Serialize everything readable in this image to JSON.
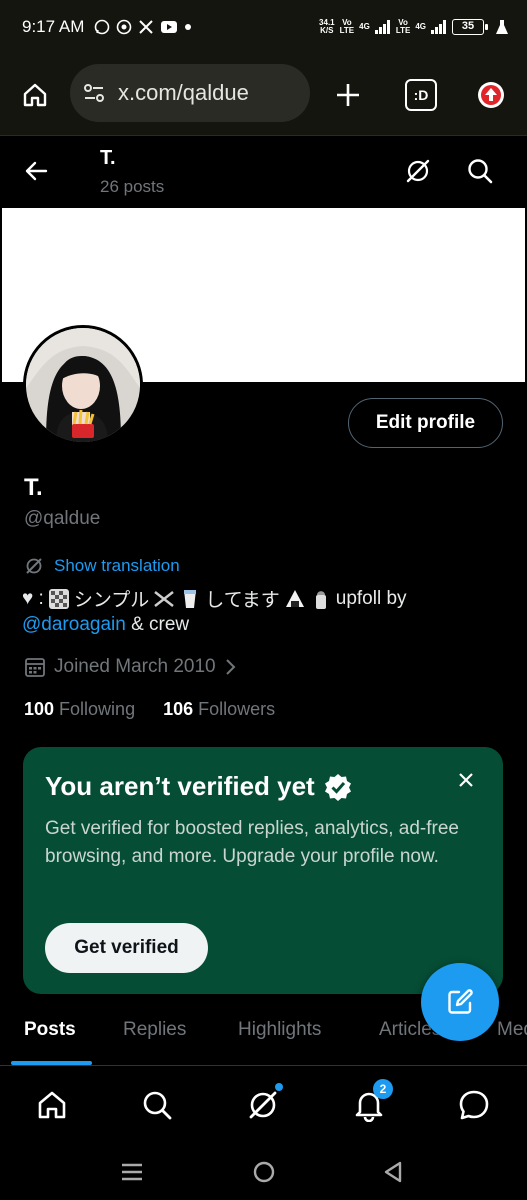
{
  "status_bar": {
    "time": "9:17 AM",
    "speed_value": "34.1",
    "speed_unit": "K/S",
    "sim1_top": "Vo",
    "sim1_bottom": "LTE",
    "net1": "4G",
    "sim2_top": "Vo",
    "sim2_bottom": "LTE",
    "net2": "4G",
    "battery": "35"
  },
  "browser": {
    "url": "x.com/qaldue",
    "tab_switcher_label": ":D"
  },
  "header": {
    "title": "T.",
    "post_count": "26 posts"
  },
  "profile": {
    "display_name": "T.",
    "handle": "@qaldue",
    "edit_label": "Edit profile",
    "show_translation": "Show translation",
    "bio_prefix": "♥︎ : ",
    "bio_word1": " シンプル ",
    "bio_word2": " してます ",
    "bio_word3": " upfoll by",
    "bio_mention": "@daroagain",
    "bio_suffix": " & crew",
    "joined": "Joined March 2010",
    "following_count": "100",
    "following_label": "Following",
    "followers_count": "106",
    "followers_label": "Followers"
  },
  "verify_card": {
    "title": "You aren’t verified yet",
    "description": "Get verified for boosted replies, analytics, ad-free browsing, and more. Upgrade your profile now.",
    "button": "Get verified"
  },
  "tabs": [
    "Posts",
    "Replies",
    "Highlights",
    "Articles",
    "Media"
  ],
  "bottom_nav": {
    "notification_badge": "2"
  },
  "colors": {
    "accent": "#1d9bf0",
    "card_bg": "#064d35",
    "secondary_text": "#71767b"
  }
}
